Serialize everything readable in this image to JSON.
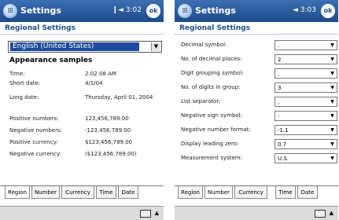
{
  "left": {
    "title": "Settings",
    "status": "❙◄ 3:02",
    "ok": "ok",
    "subheader": "Regional Settings",
    "region_value": "English (United States)",
    "samples_heading": "Appearance samples",
    "samples": [
      {
        "label": "Time:",
        "value": "2:02:08 AM"
      },
      {
        "label": "Short date:",
        "value": "4/1/04"
      },
      {
        "label": "Long date:",
        "value": "Thursday, April 01, 2004"
      },
      {
        "label": "Positive numbers:",
        "value": "123,456,789.00"
      },
      {
        "label": "Negative numbers:",
        "value": "-123,456,789.00"
      },
      {
        "label": "Positive currency:",
        "value": "$123,456,789.00"
      },
      {
        "label": "Negative currency:",
        "value": "($123,456,789.00)"
      }
    ],
    "tabs": [
      "Region",
      "Number",
      "Currency",
      "Time",
      "Date"
    ],
    "active_tab": "Region"
  },
  "right": {
    "title": "Settings",
    "status": "◄ 3:03",
    "ok": "ok",
    "subheader": "Regional Settings",
    "fields": [
      {
        "label": "Decimal symbol:",
        "value": "."
      },
      {
        "label": "No. of decimal places:",
        "value": "2"
      },
      {
        "label": "Digit grouping symbol:",
        "value": ","
      },
      {
        "label": "No. of digits in group:",
        "value": "3"
      },
      {
        "label": "List separator:",
        "value": ","
      },
      {
        "label": "Negative sign symbol:",
        "value": "-"
      },
      {
        "label": "Negative number format:",
        "value": "-1.1"
      },
      {
        "label": "Display leading zero:",
        "value": "0.7"
      },
      {
        "label": "Measurement system:",
        "value": "U.S."
      }
    ],
    "tabs": [
      "Region",
      "Number",
      "Currency",
      "Time",
      "Date"
    ],
    "active_tab": "Number"
  },
  "colors": {
    "titlebar": "#1c4a8c",
    "accent": "#1c4a9c",
    "subheader_text": "#1f4e8c"
  }
}
